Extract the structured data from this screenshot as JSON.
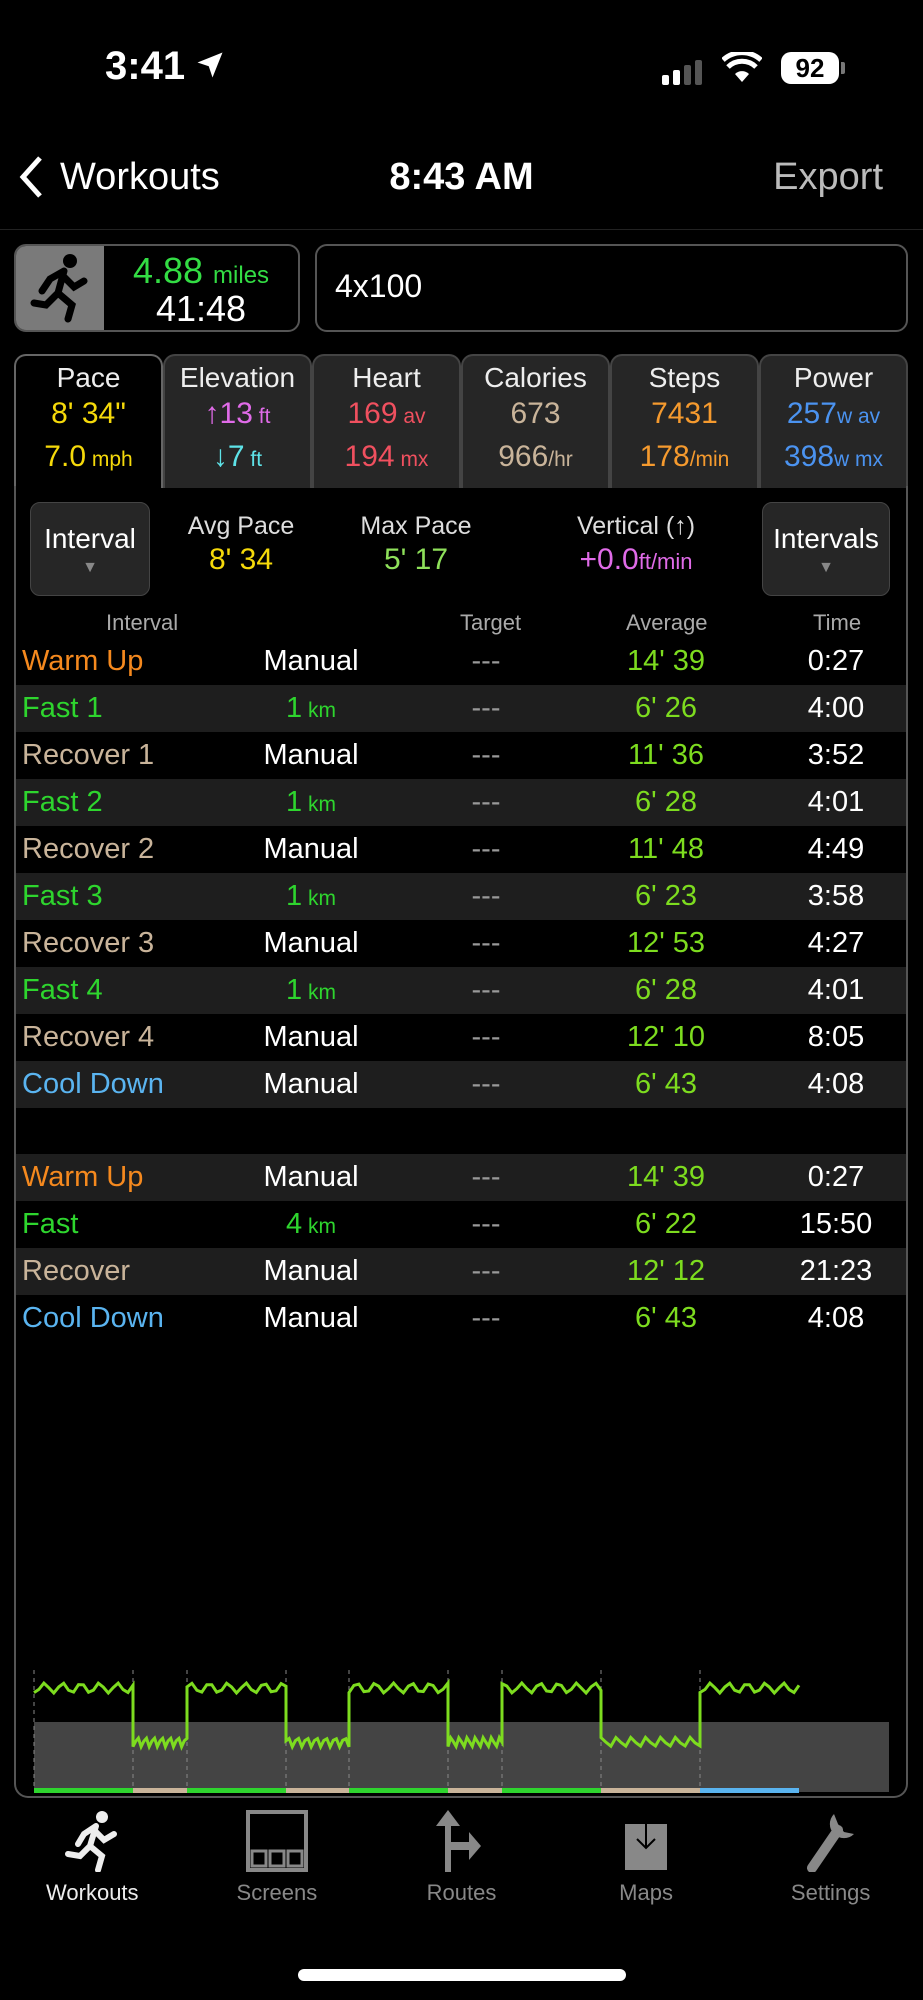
{
  "status_bar": {
    "time": "3:41",
    "battery": "92"
  },
  "nav": {
    "back_label": "Workouts",
    "title": "8:43 AM",
    "export_label": "Export"
  },
  "summary": {
    "distance": "4.88",
    "distance_unit": "miles",
    "duration": "41:48",
    "workout_name": "4x100"
  },
  "tabs": [
    {
      "label": "Pace",
      "v1": "8' 34\"",
      "u1": "",
      "v2": "7.0",
      "u2": " mph",
      "color": "#f5d90a",
      "color2": "#f5d90a"
    },
    {
      "label": "Elevation",
      "v1": "↑13",
      "u1": " ft",
      "v2": "↓7",
      "u2": " ft",
      "color": "#e06be8",
      "color2": "#5ee3e8"
    },
    {
      "label": "Heart",
      "v1": "169",
      "u1": " av",
      "v2": "194",
      "u2": " mx",
      "color": "#f0505f",
      "color2": "#f0505f"
    },
    {
      "label": "Calories",
      "v1": "673",
      "u1": "",
      "v2": "966",
      "u2": "/hr",
      "color": "#c9b49a",
      "color2": "#c9b49a"
    },
    {
      "label": "Steps",
      "v1": "7431",
      "u1": "",
      "v2": "178",
      "u2": "/min",
      "color": "#f59a2e",
      "color2": "#f59a2e"
    },
    {
      "label": "Power",
      "v1": "257",
      "u1": "w av",
      "v2": "398",
      "u2": "w mx",
      "color": "#4b93f0",
      "color2": "#4b93f0"
    }
  ],
  "controls": {
    "left_dropdown": "Interval",
    "right_dropdown": "Intervals",
    "stats": [
      {
        "label": "Avg Pace",
        "value": "8' 34",
        "color": "#f5d90a"
      },
      {
        "label": "Max Pace",
        "value": "5' 17",
        "color": "#8ee05a"
      },
      {
        "label": "Vertical (↑)",
        "value": "+0.0",
        "unit": "ft/min",
        "color": "#e06be8"
      }
    ]
  },
  "table_headers": {
    "interval": "Interval",
    "target": "Target",
    "average": "Average",
    "time": "Time"
  },
  "intervals": [
    {
      "name": "Warm Up",
      "type": "warm",
      "target": "Manual",
      "target_unit": "",
      "dash": "---",
      "average": "14' 39",
      "time": "0:27"
    },
    {
      "name": "Fast 1",
      "type": "fast",
      "target": "1",
      "target_unit": " km",
      "dash": "---",
      "average": "6' 26",
      "time": "4:00"
    },
    {
      "name": "Recover 1",
      "type": "rec",
      "target": "Manual",
      "target_unit": "",
      "dash": "---",
      "average": "11' 36",
      "time": "3:52"
    },
    {
      "name": "Fast 2",
      "type": "fast",
      "target": "1",
      "target_unit": " km",
      "dash": "---",
      "average": "6' 28",
      "time": "4:01"
    },
    {
      "name": "Recover 2",
      "type": "rec",
      "target": "Manual",
      "target_unit": "",
      "dash": "---",
      "average": "11' 48",
      "time": "4:49"
    },
    {
      "name": "Fast 3",
      "type": "fast",
      "target": "1",
      "target_unit": " km",
      "dash": "---",
      "average": "6' 23",
      "time": "3:58"
    },
    {
      "name": "Recover 3",
      "type": "rec",
      "target": "Manual",
      "target_unit": "",
      "dash": "---",
      "average": "12' 53",
      "time": "4:27"
    },
    {
      "name": "Fast 4",
      "type": "fast",
      "target": "1",
      "target_unit": " km",
      "dash": "---",
      "average": "6' 28",
      "time": "4:01"
    },
    {
      "name": "Recover 4",
      "type": "rec",
      "target": "Manual",
      "target_unit": "",
      "dash": "---",
      "average": "12' 10",
      "time": "8:05"
    },
    {
      "name": "Cool Down",
      "type": "cool",
      "target": "Manual",
      "target_unit": "",
      "dash": "---",
      "average": "6' 43",
      "time": "4:08"
    }
  ],
  "summary_intervals": [
    {
      "name": "Warm Up",
      "type": "warm",
      "target": "Manual",
      "target_unit": "",
      "dash": "---",
      "average": "14' 39",
      "time": "0:27"
    },
    {
      "name": "Fast",
      "type": "fast",
      "target": "4",
      "target_unit": " km",
      "dash": "---",
      "average": "6' 22",
      "time": "15:50"
    },
    {
      "name": "Recover",
      "type": "rec",
      "target": "Manual",
      "target_unit": "",
      "dash": "---",
      "average": "12' 12",
      "time": "21:23"
    },
    {
      "name": "Cool Down",
      "type": "cool",
      "target": "Manual",
      "target_unit": "",
      "dash": "---",
      "average": "6' 43",
      "time": "4:08"
    }
  ],
  "type_colors": {
    "warm": "#f5891e",
    "fast": "#2ed52e",
    "rec": "#c9b49a",
    "cool": "#5ab4f0"
  },
  "tabbar": [
    {
      "label": "Workouts",
      "icon": "runner-icon",
      "active": true
    },
    {
      "label": "Screens",
      "icon": "screens-icon"
    },
    {
      "label": "Routes",
      "icon": "routes-icon"
    },
    {
      "label": "Maps",
      "icon": "maps-icon"
    },
    {
      "label": "Settings",
      "icon": "wrench-icon"
    }
  ]
}
